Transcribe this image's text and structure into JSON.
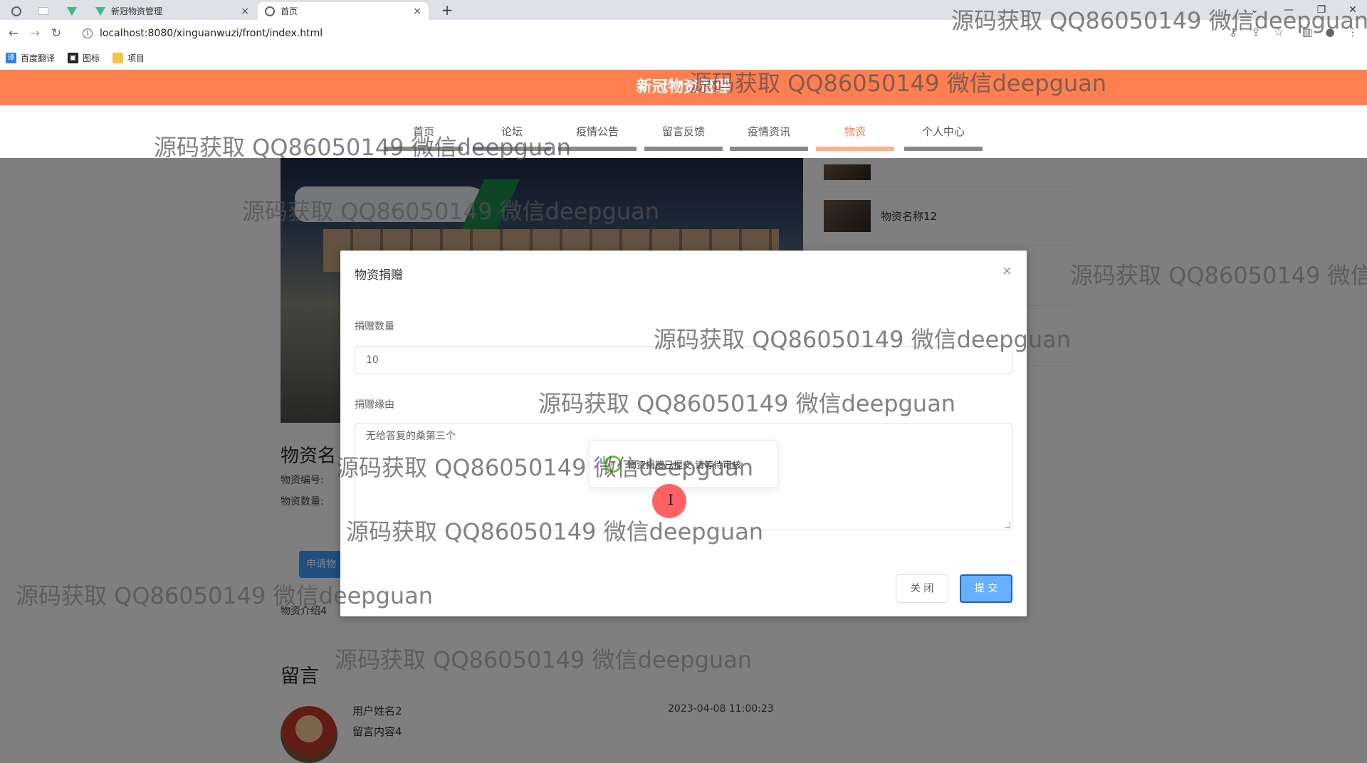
{
  "browser": {
    "tabs": [
      {
        "title": "新冠物资管理",
        "close": "×"
      },
      {
        "title": "首页",
        "close": "×"
      }
    ],
    "new_tab": "+",
    "window_controls": [
      "⌄",
      "—",
      "❐",
      "✕"
    ],
    "url": "localhost:8080/xinguanwuzi/front/index.html",
    "bookmarks": [
      "百度翻译",
      "图标",
      "项目"
    ]
  },
  "site": {
    "title": "新冠物资管理",
    "nav": [
      "首页",
      "论坛",
      "疫情公告",
      "留言反馈",
      "疫情资讯",
      "物资",
      "个人中心"
    ],
    "active_nav": "物资"
  },
  "side_list": {
    "items": [
      "物资名称12"
    ]
  },
  "detail": {
    "name": "物资名",
    "code_label": "物资编号:",
    "qty_label": "物资数量:",
    "apply_button": "申请物",
    "intro": "物资介绍4"
  },
  "comments": {
    "title": "留言",
    "user": "用户姓名2",
    "text": "留言内容4",
    "time": "2023-04-08 11:00:23"
  },
  "modal": {
    "title": "物资捐赠",
    "close_icon": "×",
    "qty_label": "捐赠数量",
    "qty_value": "10",
    "reason_label": "捐赠缘由",
    "reason_value": "无给答复的桑第三个",
    "close_button": "关 闭",
    "submit_button": "提 交"
  },
  "toast": {
    "message": "物资捐赠已提交,请等待审核"
  },
  "cursor": "I",
  "watermark": "源码获取 QQ86050149 微信deepguan",
  "colors": {
    "header": "#ff7f50",
    "primary": "#409eff",
    "success": "#67c23a"
  }
}
